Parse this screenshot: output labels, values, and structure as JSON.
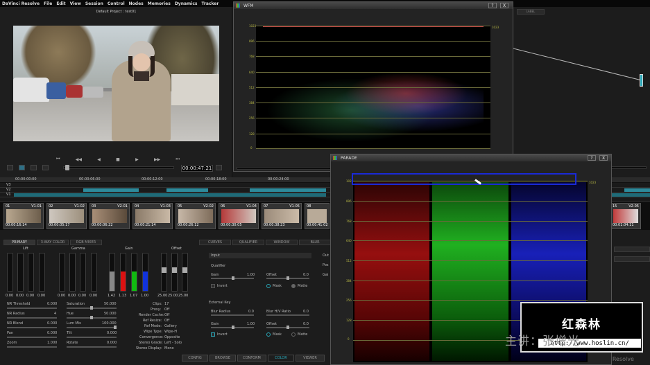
{
  "menu": [
    "DaVinci Resolve",
    "File",
    "Edit",
    "View",
    "Session",
    "Control",
    "Nodes",
    "Memories",
    "Dynamics",
    "Tracker"
  ],
  "viewer": {
    "project_title": "Default Project : test01",
    "timecode": "00:00:47:21"
  },
  "transport": [
    "⏮",
    "◀◀",
    "◀",
    "■",
    "▶",
    "▶▶",
    "⏭"
  ],
  "wfm": {
    "title": "WFM",
    "labels": [
      "1023",
      "896",
      "768",
      "640",
      "512",
      "384",
      "256",
      "128",
      "0"
    ],
    "right_label": "1023"
  },
  "parade": {
    "title": "PARADE",
    "labels": [
      "1023",
      "896",
      "768",
      "640",
      "512",
      "384",
      "256",
      "128",
      "0"
    ],
    "right_label": "1023"
  },
  "help_glyph": "?",
  "close_glyph": "X",
  "nodes_tab": "LABEL",
  "timeline": {
    "ruler": [
      "00:00:00:00",
      "00:00:06:00",
      "00:00:12:00",
      "00:00:18:00",
      "00:00:24:00"
    ],
    "tracks": [
      "V3",
      "V2",
      "V1"
    ]
  },
  "clips": [
    {
      "num": "01",
      "track": "V1-01",
      "tc": "00:00:16:14"
    },
    {
      "num": "02",
      "track": "V1-02",
      "tc": "00:00:05:17"
    },
    {
      "num": "03",
      "track": "V2-01",
      "tc": "00:00:06:22"
    },
    {
      "num": "04",
      "track": "V1-03",
      "tc": "00:00:21:14"
    },
    {
      "num": "05",
      "track": "V2-02",
      "tc": "00:00:26:12"
    },
    {
      "num": "06",
      "track": "V1-04",
      "tc": "00:00:30:05"
    },
    {
      "num": "07",
      "track": "V1-05",
      "tc": "00:00:38:23"
    },
    {
      "num": "08",
      "track": "V1-06",
      "tc": "00:00:41:02"
    },
    {
      "num": "15",
      "track": "V2-05",
      "tc": "00:01:04:11"
    }
  ],
  "panel_tabs": [
    "PRIMARY",
    "3-WAY COLOR",
    "RGB MIXER",
    "CURVES",
    "QUALIFIER",
    "WINDOW",
    "BLUR"
  ],
  "wheels": {
    "lift": {
      "label": "Lift",
      "values": [
        "0.00",
        "0.00",
        "0.00",
        "0.00"
      ]
    },
    "gamma": {
      "label": "Gamma",
      "values": [
        "0.00",
        "0.00",
        "0.00",
        "0.00"
      ]
    },
    "gain": {
      "label": "Gain",
      "values": [
        "1.42",
        "1.13",
        "1.07",
        "1.00"
      ]
    },
    "offset": {
      "label": "Offset",
      "values": [
        "25.00",
        "25.00",
        "25.00"
      ]
    }
  },
  "params_left": [
    {
      "label": "NR Threshold",
      "value": "0.000"
    },
    {
      "label": "NR Radius",
      "value": "4"
    },
    {
      "label": "NR Blend",
      "value": "0.000"
    },
    {
      "label": "Pan",
      "value": "0.000"
    },
    {
      "label": "Zoom",
      "value": "1.000"
    }
  ],
  "params_mid": [
    {
      "label": "Saturation",
      "value": "50.000"
    },
    {
      "label": "Hue",
      "value": "50.000"
    },
    {
      "label": "Lum Mix",
      "value": "100.000"
    },
    {
      "label": "Tilt",
      "value": "0.000"
    },
    {
      "label": "Rotate",
      "value": "0.000"
    }
  ],
  "clip_info": [
    {
      "label": "Clips:",
      "value": "17"
    },
    {
      "label": "Proxy:",
      "value": "Off"
    },
    {
      "label": "Render Cache:",
      "value": "Off"
    },
    {
      "label": "Ref Resize:",
      "value": "Off"
    },
    {
      "label": "Ref Mode:",
      "value": "Gallery"
    },
    {
      "label": "Wipe Type:",
      "value": "Wipe-H"
    },
    {
      "label": "Convergence:",
      "value": "Opposite"
    },
    {
      "label": "Stereo Grade:",
      "value": "Left - Solo"
    },
    {
      "label": "Stereo Display:",
      "value": "Mono"
    }
  ],
  "qualifier": {
    "input": "Input",
    "section": "Qualifier",
    "gain_label": "Gain",
    "gain_value": "1.00",
    "offset_label": "Offset",
    "offset_value": "0.0",
    "invert": "Invert",
    "mask": "Mask",
    "matte": "Matte",
    "external_key": "External Key",
    "blur_radius_label": "Blur Radius",
    "blur_radius_value": "0.0",
    "blur_ratio_label": "Blur H/V Ratio",
    "blur_ratio_value": "0.0",
    "gain2_value": "1.00",
    "offset2_value": "0.0",
    "out": "Out",
    "pos": "Pos",
    "gai": "Gai"
  },
  "bottom_tabs": [
    "CONFIG",
    "BROWSE",
    "CONFORM",
    "COLOR",
    "VIEWER"
  ],
  "brand": "DaVinci Resolve",
  "watermark": {
    "title": "红森林",
    "subtitle": "主讲：张增光",
    "url": "http://www.hoslin.cn/"
  }
}
